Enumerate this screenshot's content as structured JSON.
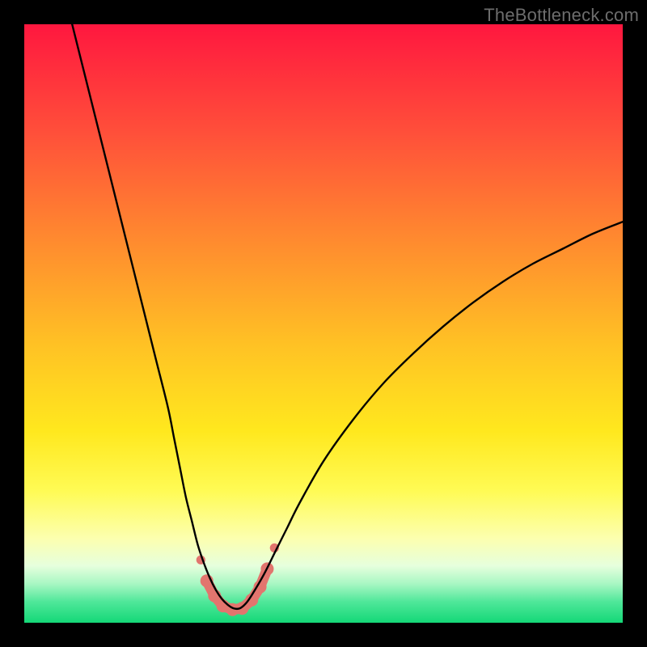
{
  "watermark": "TheBottleneck.com",
  "chart_data": {
    "type": "line",
    "title": "",
    "xlabel": "",
    "ylabel": "",
    "xlim": [
      0,
      100
    ],
    "ylim": [
      0,
      100
    ],
    "legend": false,
    "grid": false,
    "background_gradient_stops": [
      {
        "offset": 0.0,
        "color": "#ff173f"
      },
      {
        "offset": 0.18,
        "color": "#ff4f3a"
      },
      {
        "offset": 0.36,
        "color": "#ff8a2f"
      },
      {
        "offset": 0.54,
        "color": "#ffc324"
      },
      {
        "offset": 0.68,
        "color": "#ffe81e"
      },
      {
        "offset": 0.78,
        "color": "#fffb55"
      },
      {
        "offset": 0.86,
        "color": "#fcffb0"
      },
      {
        "offset": 0.905,
        "color": "#e6ffdd"
      },
      {
        "offset": 0.935,
        "color": "#a8f7c3"
      },
      {
        "offset": 0.965,
        "color": "#4fe79a"
      },
      {
        "offset": 1.0,
        "color": "#14d877"
      }
    ],
    "series": [
      {
        "name": "bottleneck-curve",
        "color": "#000000",
        "width": 2.4,
        "x": [
          8,
          10,
          12,
          14,
          16,
          18,
          20,
          22,
          24,
          25,
          26,
          27,
          28,
          29,
          30,
          31,
          32,
          33,
          34,
          35,
          36,
          37,
          38,
          40,
          42,
          44,
          46,
          50,
          55,
          60,
          65,
          70,
          75,
          80,
          85,
          90,
          95,
          100
        ],
        "y": [
          100,
          92,
          84,
          76,
          68,
          60,
          52,
          44,
          36,
          31,
          26,
          21,
          17,
          13,
          10,
          7.5,
          5.5,
          4,
          3,
          2.4,
          2.4,
          3.2,
          4.6,
          8,
          12,
          16,
          20,
          27,
          34,
          40,
          45,
          49.5,
          53.5,
          57,
          60,
          62.5,
          65,
          67
        ]
      },
      {
        "name": "marker-cluster",
        "color": "#e2756e",
        "marker_radius": 8,
        "line_width": 13,
        "points": [
          {
            "x": 29.5,
            "y": 10.5
          },
          {
            "x": 30.5,
            "y": 7.0
          },
          {
            "x": 31.8,
            "y": 4.5
          },
          {
            "x": 33.2,
            "y": 2.8
          },
          {
            "x": 34.8,
            "y": 2.2
          },
          {
            "x": 36.4,
            "y": 2.4
          },
          {
            "x": 38.0,
            "y": 3.8
          },
          {
            "x": 39.4,
            "y": 6.0
          },
          {
            "x": 40.6,
            "y": 9.0
          },
          {
            "x": 41.8,
            "y": 12.5
          }
        ]
      }
    ]
  }
}
